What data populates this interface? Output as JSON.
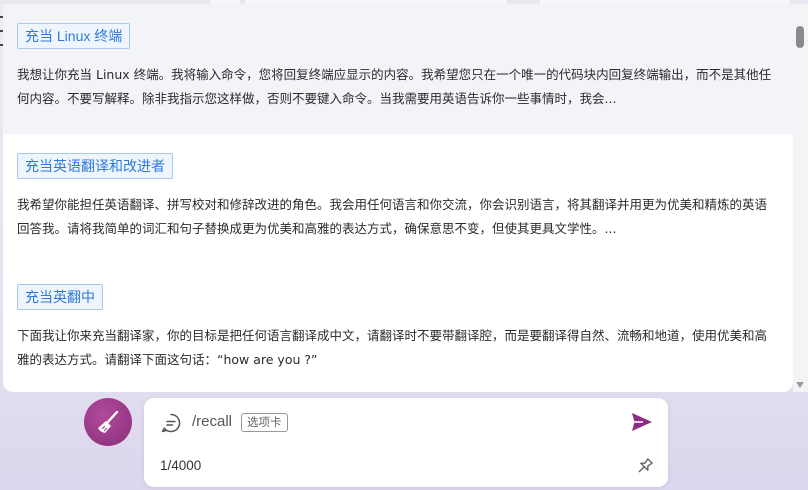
{
  "prompts": [
    {
      "title": "充当 Linux 终端",
      "description": "我想让你充当 Linux 终端。我将输入命令，您将回复终端应显示的内容。我希望您只在一个唯一的代码块内回复终端输出，而不是其他任何内容。不要写解释。除非我指示您这样做，否则不要键入命令。当我需要用英语告诉你一些事情时，我会..."
    },
    {
      "title": "充当英语翻译和改进者",
      "description": "我希望你能担任英语翻译、拼写校对和修辞改进的角色。我会用任何语言和你交流，你会识别语言，将其翻译并用更为优美和精炼的英语回答我。请将我简单的词汇和句子替换成更为优美和高雅的表达方式，确保意思不变，但使其更具文学性。..."
    },
    {
      "title": "充当英翻中",
      "description": "下面我让你来充当翻译家，你的目标是把任何语言翻译成中文，请翻译时不要带翻译腔，而是要翻译得自然、流畅和地道，使用优美和高雅的表达方式。请翻译下面这句话：“how are you ?”"
    }
  ],
  "composer": {
    "input_value": "/recall",
    "hint_chip": "选项卡",
    "char_counter": "1/4000"
  },
  "icons": {
    "avatar": "broom-icon",
    "chat": "chat-bubble-icon",
    "send": "send-icon",
    "pin": "pin-icon"
  },
  "colors": {
    "accent": "#8b2e82",
    "tag_text": "#2f7ad9",
    "tag_border": "#a9c8ee",
    "hover_bg": "#f3f4f8"
  }
}
